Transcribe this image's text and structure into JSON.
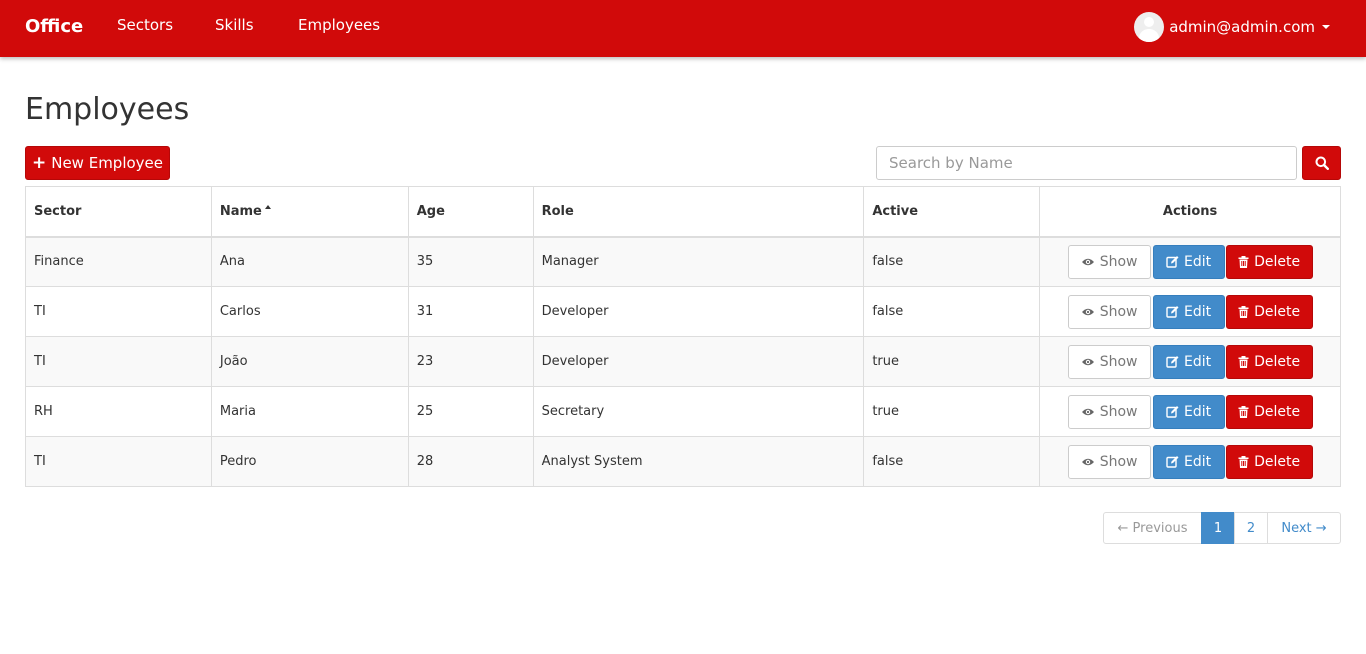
{
  "navbar": {
    "brand": "Office",
    "links": [
      "Sectors",
      "Skills",
      "Employees"
    ],
    "user": "admin@admin.com"
  },
  "page": {
    "title": "Employees",
    "new_button": "New Employee"
  },
  "search": {
    "placeholder": "Search by Name"
  },
  "table": {
    "headers": {
      "sector": "Sector",
      "name": "Name",
      "age": "Age",
      "role": "Role",
      "active": "Active",
      "actions": "Actions"
    },
    "rows": [
      {
        "sector": "Finance",
        "name": "Ana",
        "age": "35",
        "role": "Manager",
        "active": "false"
      },
      {
        "sector": "TI",
        "name": "Carlos",
        "age": "31",
        "role": "Developer",
        "active": "false"
      },
      {
        "sector": "TI",
        "name": "João",
        "age": "23",
        "role": "Developer",
        "active": "true"
      },
      {
        "sector": "RH",
        "name": "Maria",
        "age": "25",
        "role": "Secretary",
        "active": "true"
      },
      {
        "sector": "TI",
        "name": "Pedro",
        "age": "28",
        "role": "Analyst System",
        "active": "false"
      }
    ],
    "action_labels": {
      "show": "Show",
      "edit": "Edit",
      "delete": "Delete"
    }
  },
  "pagination": {
    "previous": "← Previous",
    "pages": [
      "1",
      "2"
    ],
    "current": "1",
    "next": "Next →"
  },
  "colors": {
    "brand": "#d10a0a",
    "primary": "#428bca"
  },
  "icons": {
    "search": "search-icon",
    "plus": "plus-icon",
    "show": "eye-icon",
    "edit": "edit-icon",
    "delete": "trash-icon",
    "sort": "sort-asc-icon"
  }
}
